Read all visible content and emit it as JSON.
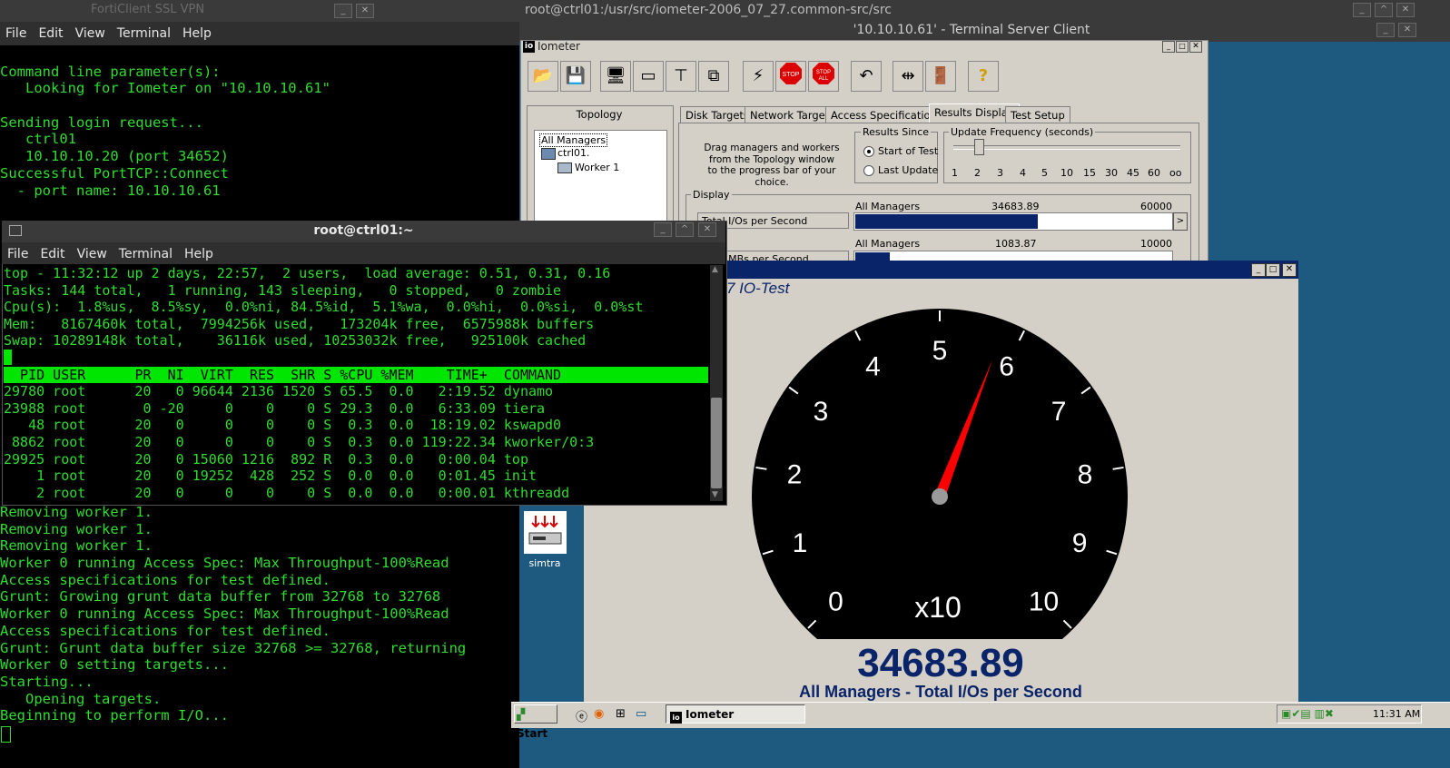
{
  "titles": {
    "forticlient": "FortiClient SSL VPN",
    "main_terminal": "root@ctrl01:/usr/src/iometer-2006_07_27.common-src/src",
    "rdp": "'10.10.10.61' - Terminal Server Client",
    "iometer": "Iometer",
    "term2": "root@ctrl01:~",
    "gauge": "7 IO-Test"
  },
  "menu": {
    "file": "File",
    "edit": "Edit",
    "view": "View",
    "terminal": "Terminal",
    "help": "Help"
  },
  "main_terminal_lines_top": [
    "",
    "Command line parameter(s):",
    "   Looking for Iometer on \"10.10.10.61\"",
    "",
    "Sending login request...",
    "   ctrl01",
    "   10.10.10.20 (port 34652)",
    "Successful PortTCP::Connect",
    "  - port name: 10.10.10.61"
  ],
  "main_terminal_lines_bottom": [
    "Removing worker 1.",
    "Removing worker 1.",
    "Removing worker 1.",
    "Worker 0 running Access Spec: Max Throughput-100%Read",
    "Access specifications for test defined.",
    "Grunt: Growing grunt data buffer from 32768 to 32768",
    "Worker 0 running Access Spec: Max Throughput-100%Read",
    "Access specifications for test defined.",
    "Grunt: Grunt data buffer size 32768 >= 32768, returning",
    "Worker 0 setting targets...",
    "Starting...",
    "   Opening targets.",
    "Beginning to perform I/O..."
  ],
  "top": {
    "lines": [
      "top - 11:32:12 up 2 days, 22:57,  2 users,  load average: 0.51, 0.31, 0.16",
      "Tasks: 144 total,   1 running, 143 sleeping,   0 stopped,   0 zombie",
      "Cpu(s):  1.8%us,  8.5%sy,  0.0%ni, 84.5%id,  5.1%wa,  0.0%hi,  0.0%si,  0.0%st",
      "Mem:   8167460k total,  7994256k used,   173204k free,  6575988k buffers",
      "Swap: 10289148k total,    36116k used, 10253032k free,   925100k cached"
    ],
    "header": "  PID USER      PR  NI  VIRT  RES  SHR S %CPU %MEM    TIME+  COMMAND",
    "rows": [
      "29780 root      20   0 96644 2136 1520 S 65.5  0.0   2:19.52 dynamo",
      "23988 root       0 -20     0    0    0 S 29.3  0.0   6:33.09 tiera",
      "   48 root      20   0     0    0    0 S  0.3  0.0  18:19.02 kswapd0",
      " 8862 root      20   0     0    0    0 S  0.3  0.0 119:22.34 kworker/0:3",
      "29925 root      20   0 15060 1216  892 R  0.3  0.0   0:00.04 top",
      "    1 root      20   0 19252  428  252 S  0.0  0.0   0:01.45 init",
      "    2 root      20   0     0    0    0 S  0.0  0.0   0:00.01 kthreadd"
    ]
  },
  "iometer": {
    "topology_label": "Topology",
    "tree": [
      "All Managers",
      "ctrl01.",
      "Worker 1"
    ],
    "tabs": [
      "Disk Targets",
      "Network Targets",
      "Access Specifications",
      "Results Display",
      "Test Setup"
    ],
    "drag_text": [
      "Drag managers and workers",
      "from the Topology window",
      "to the progress bar of your choice."
    ],
    "results_since": "Results Since",
    "start_of_test": "Start of Test",
    "last_update": "Last Update",
    "update_freq": "Update Frequency (seconds)",
    "freq_ticks": [
      "1",
      "2",
      "3",
      "4",
      "5",
      "10",
      "15",
      "30",
      "45",
      "60",
      "oo"
    ],
    "display_label": "Display",
    "row1": {
      "button": "Total I/Os per Second",
      "manager": "All Managers",
      "value": "34683.89",
      "max": "60000",
      "fill": 0.578
    },
    "row2": {
      "button": "Total MBs per Second",
      "manager": "All Managers",
      "value": "1083.87",
      "max": "10000",
      "fill": 0.108
    }
  },
  "gauge": {
    "value": "34683.89",
    "caption": "All Managers - Total I/Os per Second",
    "multiplier": "x10",
    "dial_labels": [
      "0",
      "1",
      "2",
      "3",
      "4",
      "5",
      "6",
      "7",
      "8",
      "9",
      "10"
    ],
    "needle_fraction": 0.578
  },
  "desktop": {
    "icon_label": "simtra"
  },
  "taskbar": {
    "start": "Start",
    "task": "Iometer",
    "clock": "11:31 AM"
  },
  "colors": {
    "terminal_green": "#2fdc2f",
    "top_header_bg": "#00e600",
    "gauge_value": "#0a246a",
    "progress_fill": "#0a246a",
    "needle": "#ff0000"
  }
}
